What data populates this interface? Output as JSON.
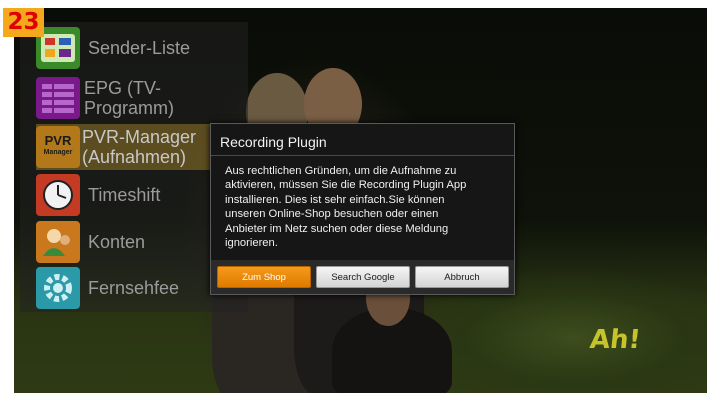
{
  "badge": "23",
  "menu": {
    "items": [
      {
        "label": "Sender-Liste",
        "icon": "channel-list-icon",
        "color": "#3a8a2a"
      },
      {
        "label": "EPG (TV-\nProgramm)",
        "icon": "epg-grid-icon",
        "color": "#7a1a8a"
      },
      {
        "label": "PVR-Manager\n(Aufnahmen)",
        "icon": "pvr-manager-icon",
        "icon_text": "PVR",
        "icon_subtext": "Manager",
        "color": "#b3781a",
        "selected": true
      },
      {
        "label": "Timeshift",
        "icon": "clock-icon",
        "color": "#c43a22"
      },
      {
        "label": "Konten",
        "icon": "accounts-icon",
        "color": "#c9781e"
      },
      {
        "label": "Fernsehfee",
        "icon": "gear-icon",
        "color": "#2a9aa8"
      }
    ]
  },
  "dialog": {
    "title": "Recording Plugin",
    "message": "Aus rechtlichen Gründen, um die Aufnahme zu\naktivieren, müssen Sie die Recording Plugin App\ninstallieren. Dies ist sehr einfach.Sie können\nunseren Online-Shop besuchen oder einen\nAnbieter im Netz suchen oder diese Meldung\nignorieren.",
    "buttons": {
      "shop": "Zum Shop",
      "google": "Search Google",
      "cancel": "Abbruch"
    },
    "accent_color": "#f39a1a"
  },
  "channel_logo": "Ah!"
}
